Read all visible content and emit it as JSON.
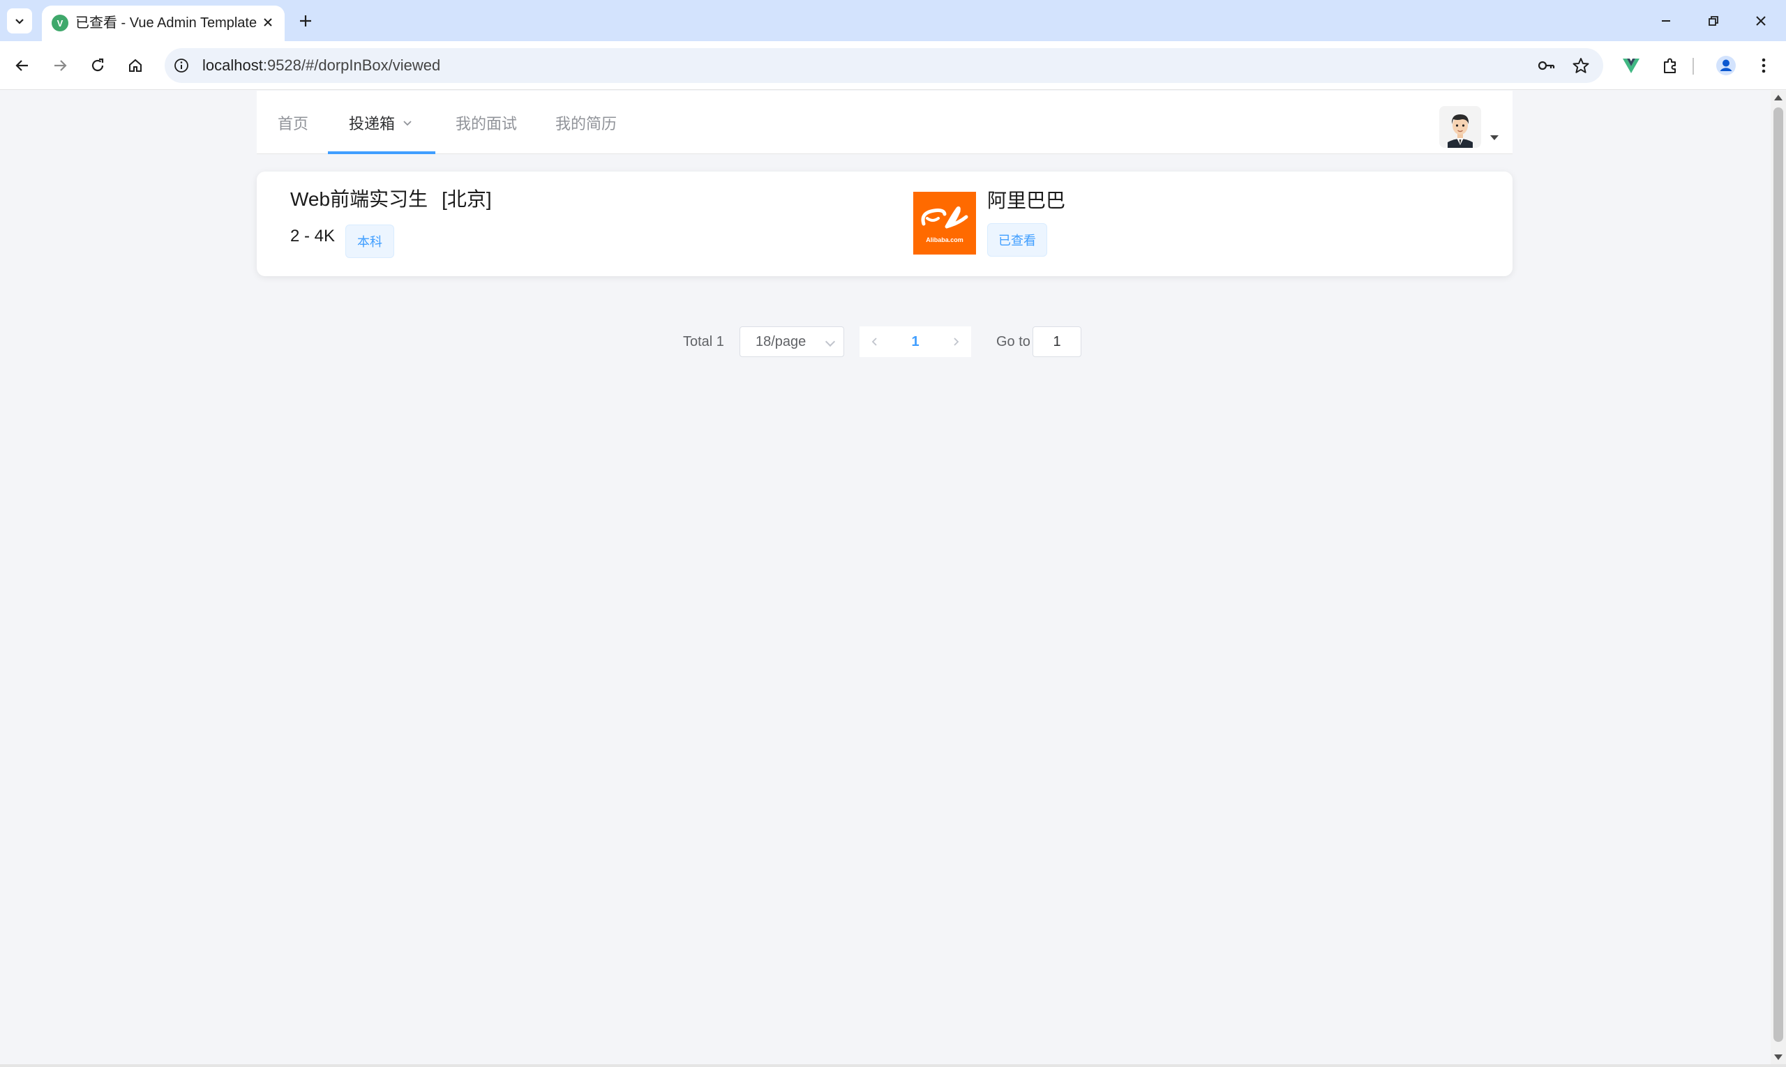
{
  "browser": {
    "tab_title": "已查看 - Vue Admin Template",
    "favicon_letter": "V",
    "url_host": "localhost",
    "url_rest": ":9528/#/dorpInBox/viewed"
  },
  "nav": {
    "items": [
      {
        "label": "首页"
      },
      {
        "label": "投递箱"
      },
      {
        "label": "我的面试"
      },
      {
        "label": "我的简历"
      }
    ],
    "active_index": 1
  },
  "job": {
    "title": "Web前端实习生",
    "city": "[北京]",
    "salary": "2 - 4K",
    "degree_tag": "本科",
    "company": "阿里巴巴",
    "status_tag": "已查看",
    "company_logo_text": "Alibaba.com",
    "logo_color": "#ff6a00"
  },
  "pagination": {
    "total_text": "Total 1",
    "page_size": "18/page",
    "current_page": "1",
    "goto_label": "Go to",
    "goto_value": "1"
  },
  "colors": {
    "accent": "#409eff",
    "tab_strip": "#d3e3fd"
  }
}
